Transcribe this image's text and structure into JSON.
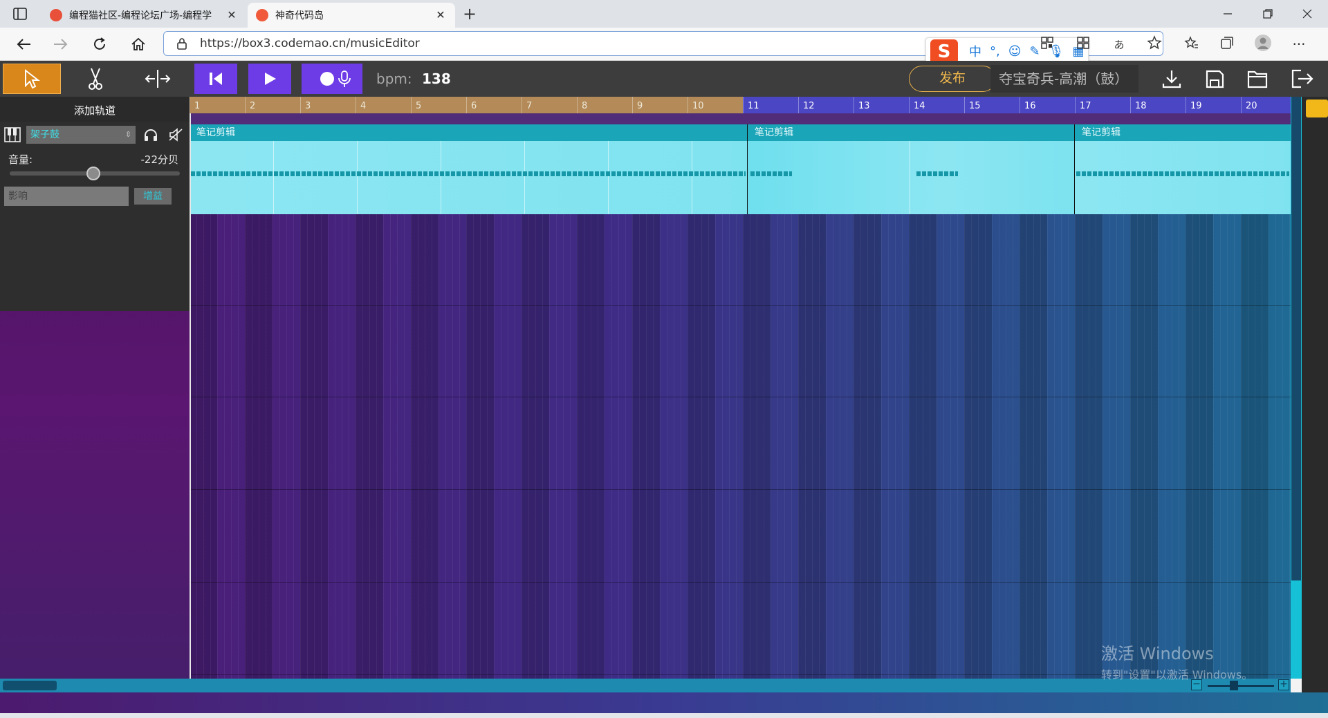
{
  "browser": {
    "tabs": [
      {
        "title": "编程猫社区-编程论坛广场-编程学",
        "close": "✕"
      },
      {
        "title": "神奇代码岛",
        "close": "✕"
      }
    ],
    "new_tab": "+",
    "url": "https://box3.codemao.cn/musicEditor",
    "ime": {
      "logo": "S",
      "mode": "中",
      "punct": "°,"
    }
  },
  "toolbar": {
    "bpm_label": "bpm:",
    "bpm_value": "138",
    "publish_label": "发布",
    "song_name": "夺宝奇兵-高潮（鼓）"
  },
  "track_panel": {
    "add_track_label": "添加轨道",
    "instrument": "架子鼓",
    "volume_label": "音量:",
    "volume_value": "-22分贝",
    "volume_level": 0.49,
    "effect_placeholder": "影响",
    "gain_label": "增益"
  },
  "timeline": {
    "measures": [
      "1",
      "2",
      "3",
      "4",
      "5",
      "6",
      "7",
      "8",
      "9",
      "10",
      "11",
      "12",
      "13",
      "14",
      "15",
      "16",
      "17",
      "18",
      "19",
      "20"
    ],
    "played_through": 10
  },
  "clips": [
    {
      "label": "笔记剪辑"
    },
    {
      "label": "笔记剪辑"
    },
    {
      "label": "笔记剪辑"
    }
  ],
  "watermark": {
    "line1": "激活 Windows",
    "line2": "转到\"设置\"以激活 Windows。"
  },
  "colors": {
    "accent_orange": "#d9861b",
    "play_purple": "#6e3ce6",
    "clip_teal": "#1aa6b8",
    "instrument_text": "#3fe0e8"
  }
}
